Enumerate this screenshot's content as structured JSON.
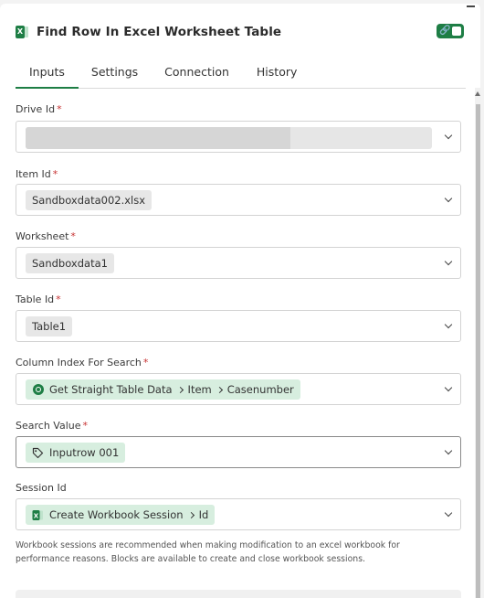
{
  "header": {
    "title": "Find Row In Excel Worksheet Table",
    "app_icon": "excel-icon",
    "toggle_icon": "link-icon"
  },
  "tabs": [
    {
      "label": "Inputs",
      "active": true
    },
    {
      "label": "Settings",
      "active": false
    },
    {
      "label": "Connection",
      "active": false
    },
    {
      "label": "History",
      "active": false
    }
  ],
  "fields": {
    "drive_id": {
      "label": "Drive Id",
      "required": "*",
      "value": ""
    },
    "item_id": {
      "label": "Item Id",
      "required": "*",
      "value": "Sandboxdata002.xlsx"
    },
    "worksheet": {
      "label": "Worksheet",
      "required": "*",
      "value": "Sandboxdata1"
    },
    "table_id": {
      "label": "Table Id",
      "required": "*",
      "value": "Table1"
    },
    "column_index": {
      "label": "Column Index For Search",
      "required": "*",
      "path": [
        "Get Straight Table Data",
        "Item",
        "Casenumber"
      ]
    },
    "search_value": {
      "label": "Search Value",
      "required": "*",
      "value": "Inputrow 001"
    },
    "session_id": {
      "label": "Session Id",
      "path": [
        "Create Workbook Session",
        "Id"
      ]
    }
  },
  "help_text": "Workbook sessions are recommended when making modification to an excel workbook for performance reasons. Blocks are available to create and close workbook sessions.",
  "colors": {
    "accent": "#1e7e45",
    "required": "#c73232"
  }
}
